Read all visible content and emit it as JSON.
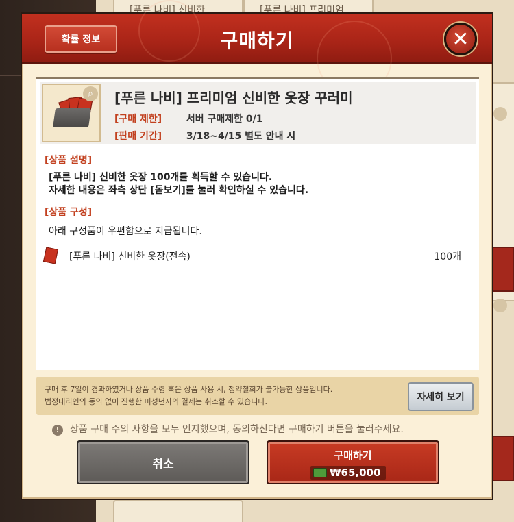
{
  "background": {
    "top_card_1": "[푸른 나비] 신비한",
    "top_card_2": "[푸른 나비] 프리미엄"
  },
  "modal": {
    "title": "구매하기",
    "prob_info_label": "확률 정보",
    "close_icon": "x-close-icon"
  },
  "item": {
    "title": "[푸른 나비] 프리미엄 신비한 옷장 꾸러미",
    "purchase_limit_label": "[구매 제한]",
    "purchase_limit_value": "서버 구매제한 0/1",
    "sale_period_label": "[판매 기간]",
    "sale_period_value": "3/18~4/15 별도 안내 시"
  },
  "description": {
    "header": "[상품 설명]",
    "line1": "[푸른 나비] 신비한 옷장 100개를 획득할 수 있습니다.",
    "line2": "자세한 내용은 좌측 상단 [돋보기]를 눌러 확인하실 수 있습니다."
  },
  "composition": {
    "header": "[상품 구성]",
    "note": "아래 구성품이 우편함으로 지급됩니다.",
    "items": [
      {
        "name": "[푸른 나비] 신비한 옷장(전속)",
        "qty": "100개"
      }
    ]
  },
  "notice": {
    "line1": "구매 후 7일이 경과하였거나 상품 수령 혹은 상품 사용 시, 청약철회가 불가능한 상품입니다.",
    "line2": "법정대리인의 동의 없이 진행한 미성년자의 결제는 취소할 수 있습니다.",
    "detail_label": "자세히 보기"
  },
  "agree_text": "상품 구매 주의 사항을 모두 인지했으며, 동의하신다면 구매하기 버튼을 눌러주세요.",
  "buttons": {
    "cancel": "취소",
    "buy": "구매하기",
    "price": "₩65,000"
  },
  "colors": {
    "header_red": "#a82417",
    "accent_label": "#c2401f",
    "panel_bg": "#fbf0d8"
  }
}
